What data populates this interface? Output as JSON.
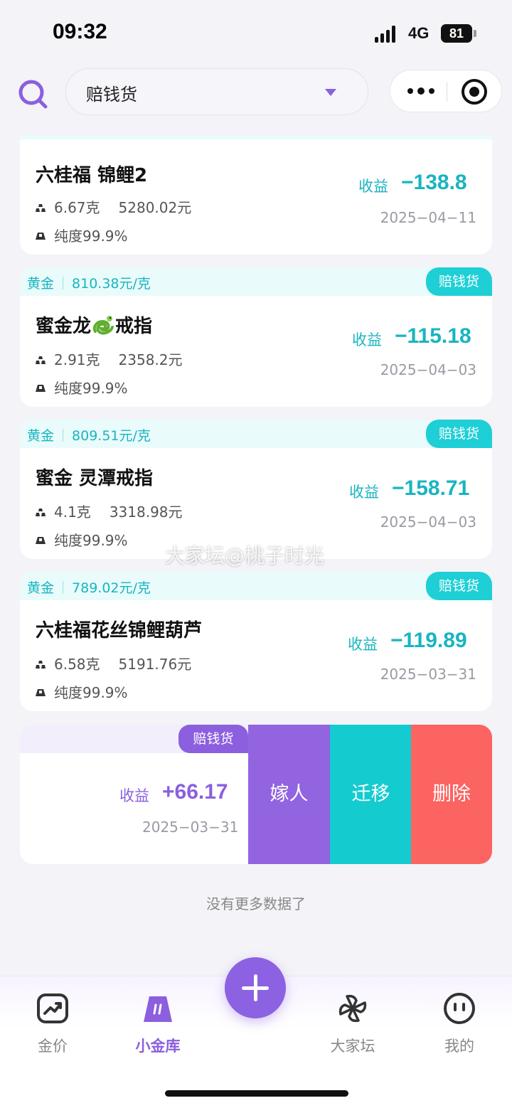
{
  "status": {
    "time": "09:32",
    "network": "4G",
    "battery": "81"
  },
  "filter": {
    "label": "赔钱货"
  },
  "cards": [
    {
      "title": "六桂福 锦鲤2",
      "weight": "6.67克",
      "price": "5280.02元",
      "purity": "纯度99.9%",
      "income_label": "收益",
      "income": "−138.8",
      "date": "2025−04−11"
    },
    {
      "head_metal": "黄金",
      "head_price": "810.38元/克",
      "tag": "赔钱货",
      "title_a": "蜜金龙",
      "title_b": "戒指",
      "weight": "2.91克",
      "price": "2358.2元",
      "purity": "纯度99.9%",
      "income_label": "收益",
      "income": "−115.18",
      "date": "2025−04−03"
    },
    {
      "head_metal": "黄金",
      "head_price": "809.51元/克",
      "tag": "赔钱货",
      "title": "蜜金 灵潭戒指",
      "weight": "4.1克",
      "price": "3318.98元",
      "purity": "纯度99.9%",
      "income_label": "收益",
      "income": "−158.71",
      "date": "2025−04−03"
    },
    {
      "head_metal": "黄金",
      "head_price": "789.02元/克",
      "tag": "赔钱货",
      "title": "六桂福花丝锦鲤葫芦",
      "weight": "6.58克",
      "price": "5191.76元",
      "purity": "纯度99.9%",
      "income_label": "收益",
      "income": "−119.89",
      "date": "2025−03−31"
    }
  ],
  "swipe_card": {
    "tag": "赔钱货",
    "income_label": "收益",
    "income": "+66.17",
    "date": "2025−03−31",
    "actions": {
      "marry": "嫁人",
      "move": "迁移",
      "delete": "删除"
    }
  },
  "no_more": "没有更多数据了",
  "watermark": "大家坛@桃子时光",
  "tabs": [
    {
      "label": "金价",
      "icon": "chart-trend-icon"
    },
    {
      "label": "小金库",
      "icon": "gold-bar-icon"
    },
    {
      "label": "大家坛",
      "icon": "pinwheel-icon"
    },
    {
      "label": "我的",
      "icon": "face-icon"
    }
  ],
  "colors": {
    "accent_purple": "#8b5fde",
    "teal": "#18b5c0",
    "delete_red": "#fb6461"
  }
}
